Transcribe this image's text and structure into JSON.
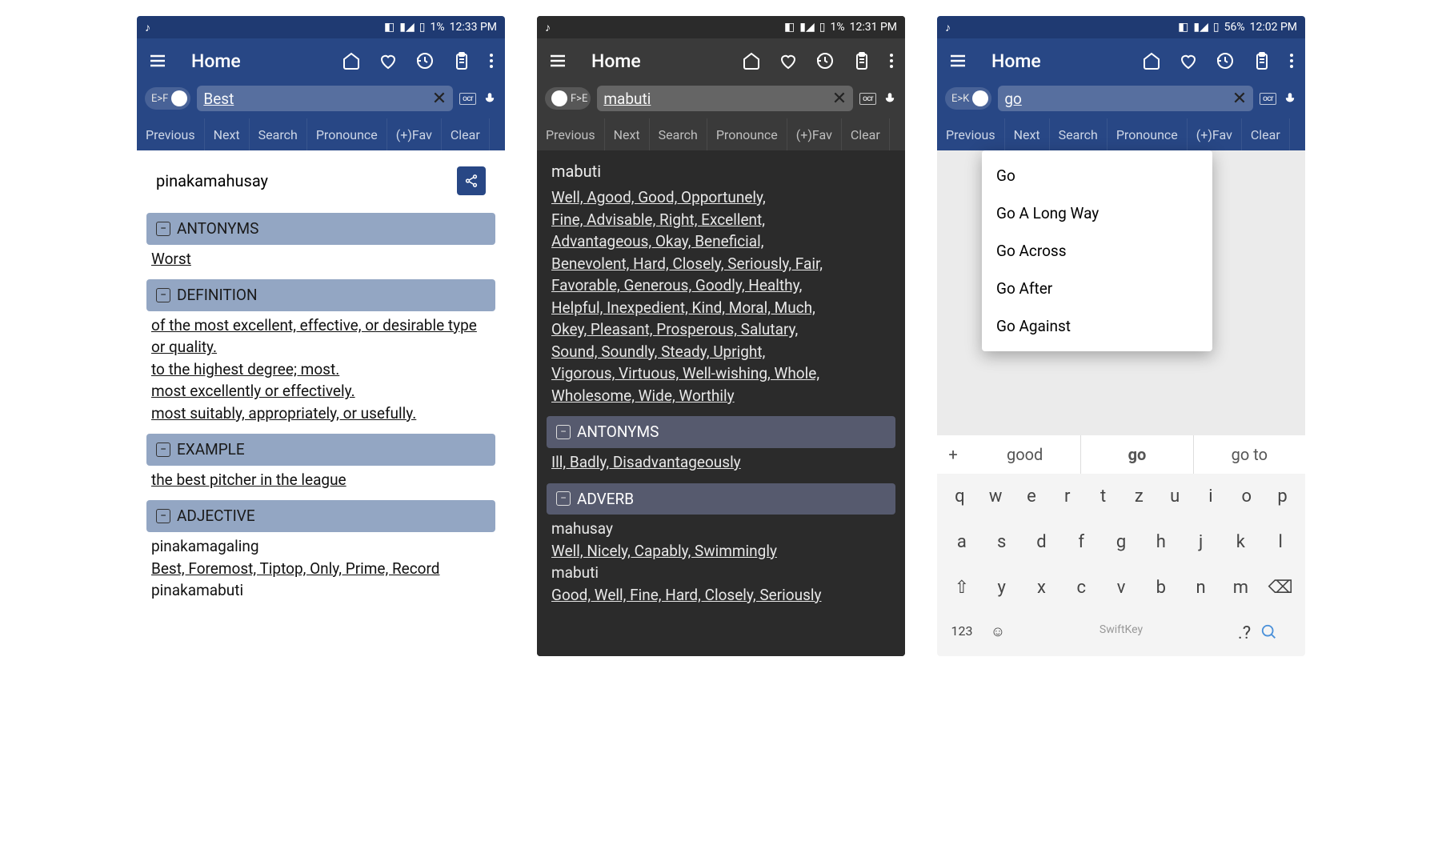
{
  "screens": [
    {
      "theme": "light",
      "status": {
        "battery_pct": "1%",
        "time": "12:33 PM"
      },
      "title": "Home",
      "lang_toggle": "E>F",
      "search_value": "Best",
      "tabs": [
        "Previous",
        "Next",
        "Search",
        "Pronounce",
        "(+)Fav",
        "Clear"
      ],
      "result_word": "pinakamahusay",
      "sections": [
        {
          "title": "ANTONYMS",
          "body": [
            {
              "u": true,
              "t": "Worst"
            }
          ]
        },
        {
          "title": "DEFINITION",
          "body": [
            {
              "u": true,
              "t": "of the most excellent, effective, or desirable type or quality."
            },
            {
              "u": true,
              "t": "to the highest degree; most."
            },
            {
              "u": true,
              "t": "most excellently or effectively."
            },
            {
              "u": true,
              "t": "most suitably, appropriately, or usefully."
            }
          ]
        },
        {
          "title": "EXAMPLE",
          "body": [
            {
              "u": true,
              "t": "the best pitcher in the league"
            }
          ]
        },
        {
          "title": "ADJECTIVE",
          "body": [
            {
              "u": false,
              "t": "pinakamagaling"
            },
            {
              "u": true,
              "t": "Best, Foremost, Tiptop, Only, Prime, Record"
            },
            {
              "u": false,
              "t": "pinakamabuti"
            }
          ]
        }
      ]
    },
    {
      "theme": "dark",
      "status": {
        "battery_pct": "1%",
        "time": "12:31 PM"
      },
      "title": "Home",
      "lang_toggle": "F>E",
      "search_value": "mabuti",
      "tabs": [
        "Previous",
        "Next",
        "Search",
        "Pronounce",
        "(+)Fav",
        "Clear"
      ],
      "headword": "mabuti",
      "syn_lines": [
        "Well, Agood, Good, Opportunely,",
        "Fine, Advisable, Right, Excellent,",
        "Advantageous, Okay, Beneficial,",
        "Benevolent, Hard, Closely, Seriously, Fair,",
        "Favorable, Generous, Goodly, Healthy,",
        "Helpful, Inexpedient, Kind, Moral, Much,",
        "Okey, Pleasant, Prosperous, Salutary,",
        "Sound, Soundly, Steady, Upright,",
        "Vigorous, Virtuous, Well-wishing, Whole,",
        "Wholesome, Wide, Worthily"
      ],
      "sections": [
        {
          "title": "ANTONYMS",
          "body": [
            {
              "u": true,
              "t": "Ill, Badly, Disadvantageously"
            }
          ]
        },
        {
          "title": "ADVERB",
          "body": [
            {
              "u": false,
              "t": "mahusay"
            },
            {
              "u": true,
              "t": "Well, Nicely, Capably, Swimmingly"
            },
            {
              "u": false,
              "t": "mabuti"
            },
            {
              "u": true,
              "t": "Good, Well, Fine, Hard, Closely, Seriously"
            }
          ]
        }
      ]
    },
    {
      "theme": "light",
      "status": {
        "battery_pct": "56%",
        "time": "12:02 PM"
      },
      "title": "Home",
      "lang_toggle": "E>K",
      "search_value": "go",
      "tabs": [
        "Previous",
        "Next",
        "Search",
        "Pronounce",
        "(+)Fav",
        "Clear"
      ],
      "suggestions": [
        "Go",
        "Go A Long Way",
        "Go Across",
        "Go After",
        "Go Against"
      ],
      "kbd_suggest": {
        "left": "good",
        "center": "go",
        "right": "go to"
      },
      "kbd_rows": [
        [
          "q",
          "w",
          "e",
          "r",
          "t",
          "z",
          "u",
          "i",
          "o",
          "p"
        ],
        [
          "a",
          "s",
          "d",
          "f",
          "g",
          "h",
          "j",
          "k",
          "l"
        ],
        [
          "⇧",
          "y",
          "x",
          "c",
          "v",
          "b",
          "n",
          "m",
          "⌫"
        ]
      ],
      "kbd_bottom": {
        "left": "123",
        "brand": "SwiftKey"
      }
    }
  ]
}
